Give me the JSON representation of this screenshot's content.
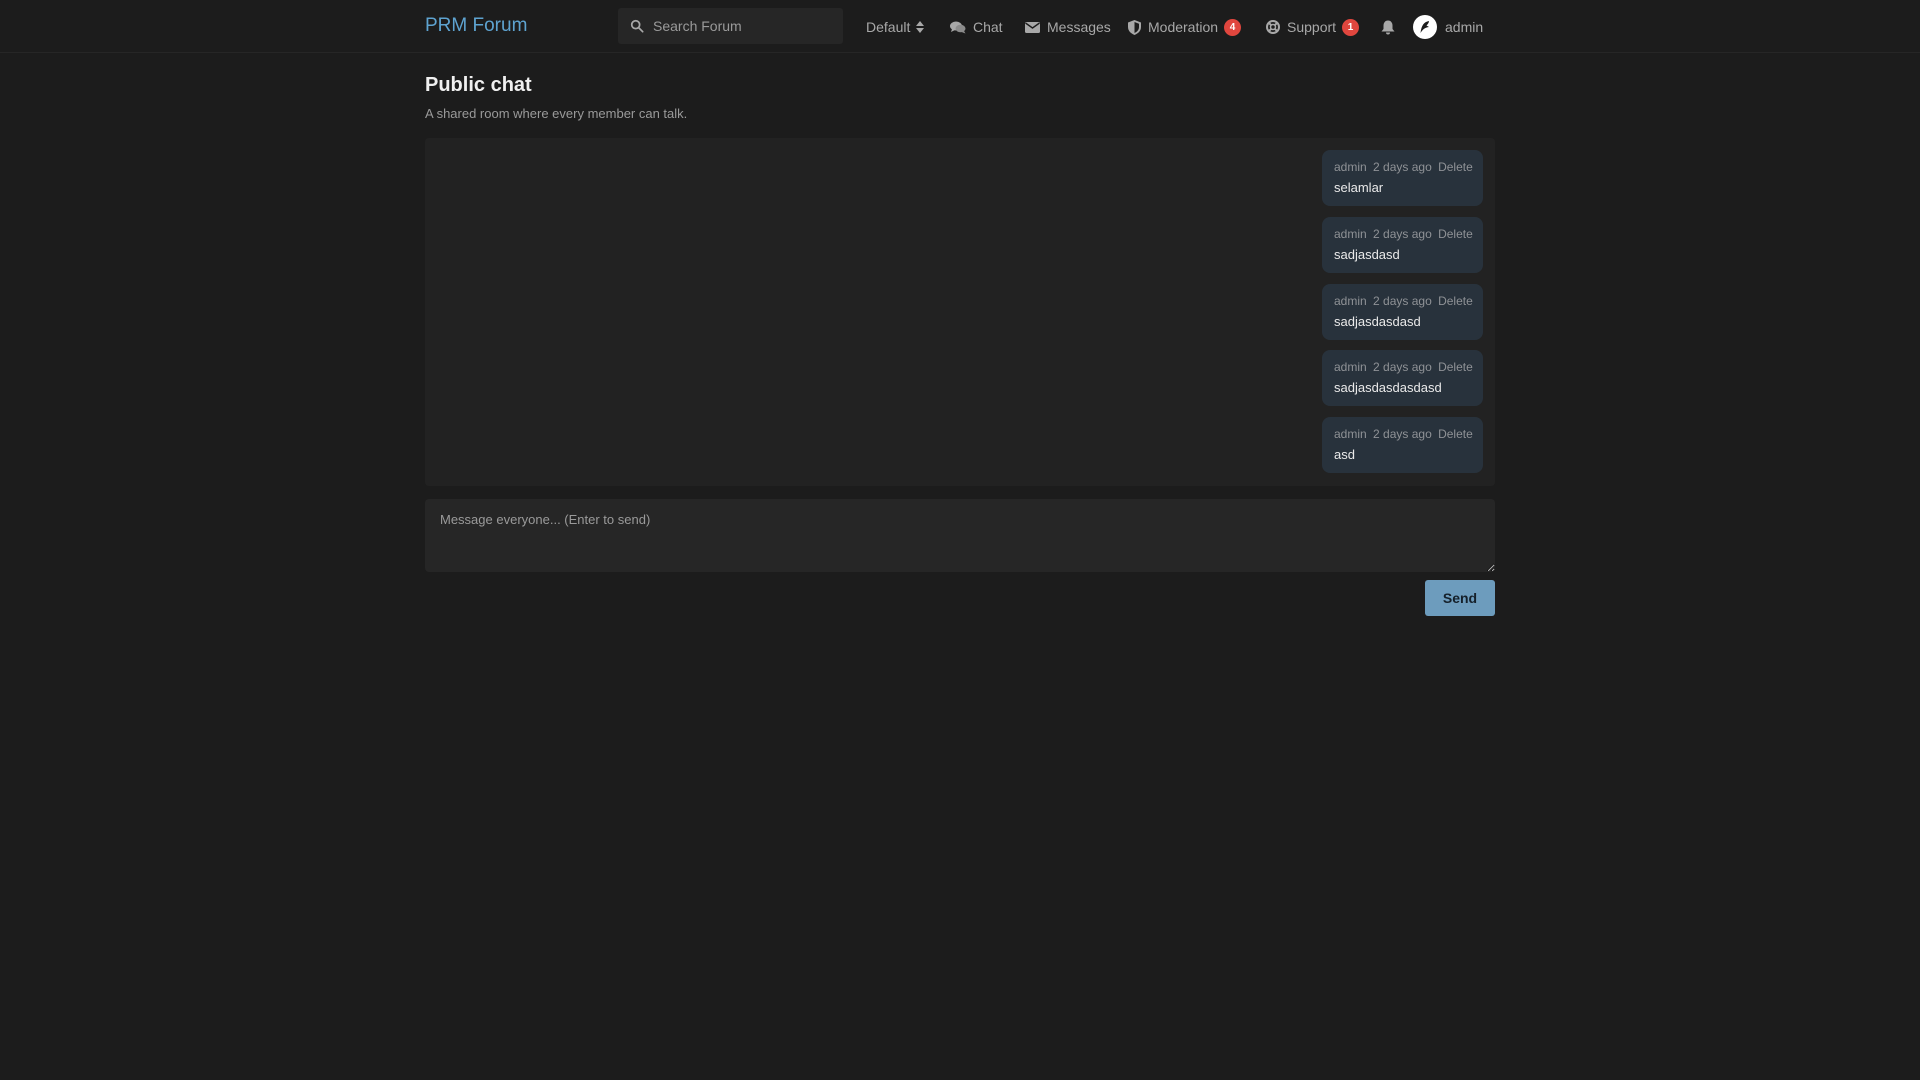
{
  "header": {
    "brand": "PRM Forum",
    "search_placeholder": "Search Forum",
    "theme_label": "Default",
    "nav": {
      "chat": "Chat",
      "messages": "Messages",
      "moderation": "Moderation",
      "moderation_badge": "4",
      "support": "Support",
      "support_badge": "1",
      "user": "admin"
    },
    "colors": {
      "brand": "#5ea3d0",
      "badge": "#e0463e"
    }
  },
  "page": {
    "title": "Public chat",
    "subtitle": "A shared room where every member can talk."
  },
  "messages": [
    {
      "author": "admin",
      "time": "2 days ago",
      "delete_label": "Delete",
      "text": "selamlar"
    },
    {
      "author": "admin",
      "time": "2 days ago",
      "delete_label": "Delete",
      "text": "sadjasdasd"
    },
    {
      "author": "admin",
      "time": "2 days ago",
      "delete_label": "Delete",
      "text": "sadjasdasdasd"
    },
    {
      "author": "admin",
      "time": "2 days ago",
      "delete_label": "Delete",
      "text": "sadjasdasdasdasd"
    },
    {
      "author": "admin",
      "time": "2 days ago",
      "delete_label": "Delete",
      "text": "asd"
    }
  ],
  "composer": {
    "placeholder": "Message everyone... (Enter to send)",
    "value": "",
    "send_label": "Send"
  }
}
